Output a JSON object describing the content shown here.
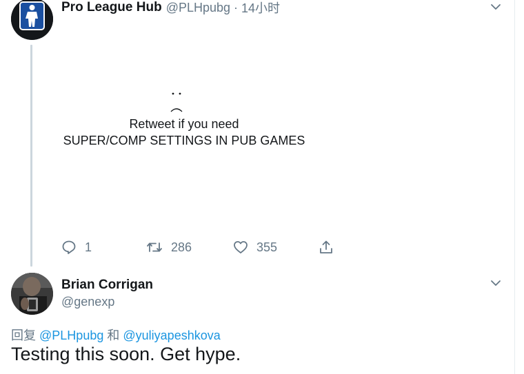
{
  "tweet1": {
    "author_name": "Pro League Hub",
    "author_handle": "@PLHpubg",
    "separator": "·",
    "time": "14小时",
    "emote_eyes": "· ·",
    "body_line1": "Retweet if you need",
    "body_line2": "SUPER/COMP SETTINGS IN PUB GAMES",
    "reply_count": "1",
    "retweet_count": "286",
    "like_count": "355"
  },
  "tweet2": {
    "author_name": "Brian Corrigan",
    "author_handle": "@genexp",
    "reply_prefix": "回复",
    "reply_to_1": "@PLHpubg",
    "reply_conj": "和",
    "reply_to_2": "@yuliyapeshkova",
    "text": "Testing this soon. Get hype."
  },
  "colors": {
    "text_primary": "#14171a",
    "text_secondary": "#657786",
    "link": "#1b95e0",
    "thread_line": "#ccd6dd"
  },
  "icons": {
    "more": "chevron-down-icon",
    "reply": "comment-icon",
    "retweet": "retweet-icon",
    "like": "heart-icon",
    "share": "share-icon"
  }
}
